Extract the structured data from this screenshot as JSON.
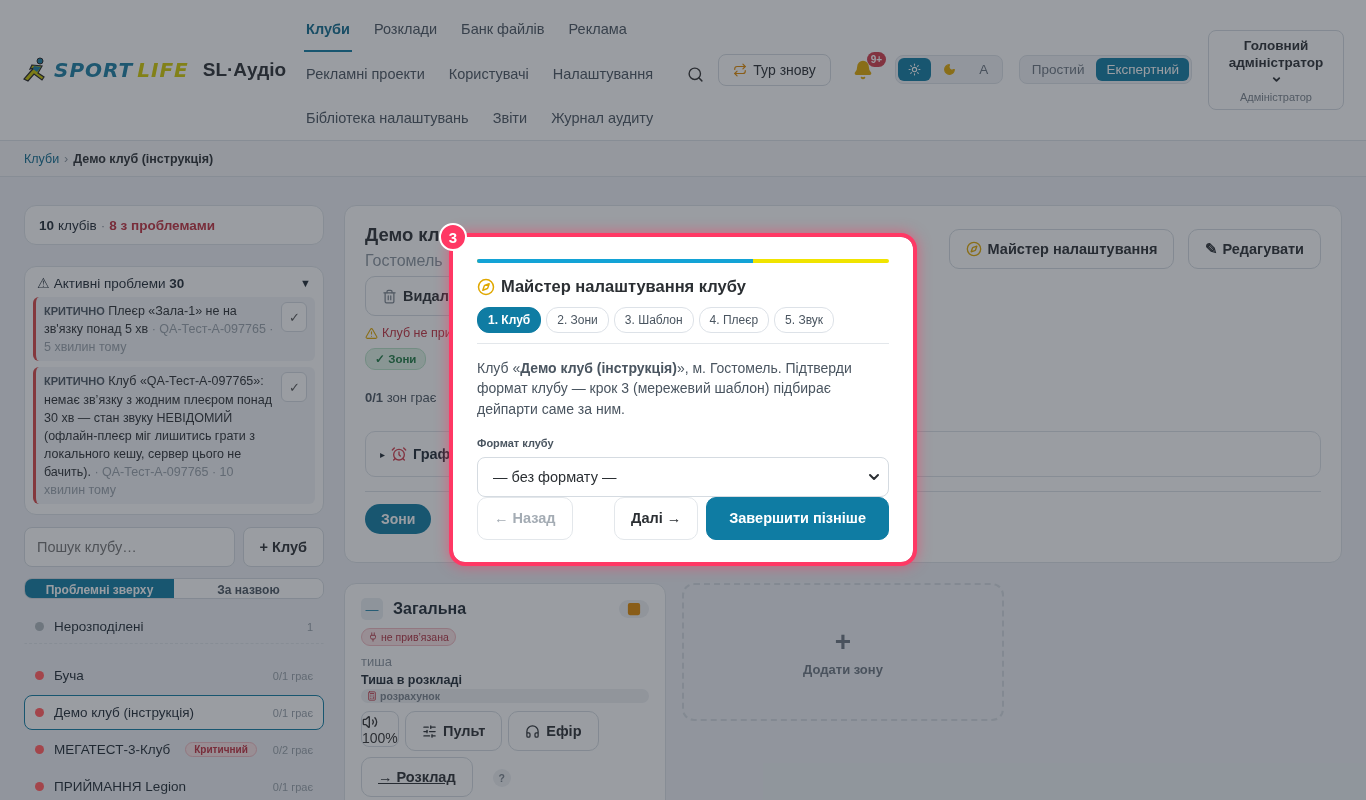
{
  "header": {
    "logo": {
      "word1": "SPORT",
      "word2": "LIFE"
    },
    "app_name": "SL·Аудіо",
    "nav_rows": [
      [
        {
          "label": "Клуби",
          "selected": true
        },
        {
          "label": "Розклади",
          "selected": false
        },
        {
          "label": "Банк файлів",
          "selected": false
        },
        {
          "label": "Реклама",
          "selected": false
        }
      ],
      [
        {
          "label": "Рекламні проекти",
          "selected": false
        },
        {
          "label": "Користувачі",
          "selected": false
        },
        {
          "label": "Налаштування",
          "selected": false
        }
      ],
      [
        {
          "label": "Бібліотека налаштувань",
          "selected": false
        },
        {
          "label": "Звіти",
          "selected": false
        },
        {
          "label": "Журнал аудиту",
          "selected": false
        }
      ]
    ],
    "tour_button": "Тур знову",
    "notifications_badge": "9+",
    "theme_options": [
      {
        "kind": "sun",
        "selected": true
      },
      {
        "kind": "moon",
        "selected": false
      },
      {
        "kind": "text",
        "label": "A",
        "selected": false
      }
    ],
    "mode_options": [
      {
        "label": "Простий",
        "selected": false
      },
      {
        "label": "Експертний",
        "selected": true
      }
    ],
    "user": {
      "name": "Головний адміністратор",
      "role": "Адміністратор"
    }
  },
  "breadcrumb": {
    "items": [
      {
        "label": "Клуби",
        "kind": "link"
      },
      {
        "label": "Демо клуб (інструкція)",
        "kind": "current"
      }
    ],
    "separator": "›"
  },
  "sidebar": {
    "summary": {
      "count": "10",
      "label": "клубів",
      "separator": "·",
      "problems": "8 з проблемами"
    },
    "issues": {
      "icon": "⚠",
      "title": "Активні проблеми",
      "count": "30",
      "toggle": "▼",
      "items": [
        {
          "level": "КРИТИЧНО",
          "message": "Плеєр «Зала-1» не на зв'язку понад 5 хв",
          "meta": "· QA-Тест-А-097765 · 5 хвилин тому",
          "button": "✓"
        },
        {
          "level": "КРИТИЧНО",
          "message": "Клуб «QA-Тест-А-097765»: немає зв’язку з жодним плеєром понад 30 хв — стан звуку НЕВІДОМИЙ (офлайн-плеєр міг лишитись грати з локального кешу, сервер цього не бачить).",
          "meta": "· QA-Тест-А-097765 · 10 хвилин тому",
          "button": "✓"
        }
      ]
    },
    "search": {
      "placeholder": "Пошук клубу…"
    },
    "add_button": "+ Клуб",
    "sort_tabs": [
      {
        "label": "Проблемні зверху",
        "selected": true
      },
      {
        "label": "За назвою",
        "selected": false
      }
    ],
    "clubs": [
      {
        "kind": "group",
        "name": "Нерозподілені",
        "color": "#6e767e",
        "count": "1",
        "selected": false
      },
      {
        "kind": "club",
        "name": "Буча",
        "color": "#a3454b",
        "status": "0/1 грає",
        "selected": false
      },
      {
        "kind": "club",
        "name": "Демо клуб (інструкція)",
        "color": "#a3454b",
        "status": "0/1 грає",
        "selected": true
      },
      {
        "kind": "club",
        "name": "МЕГАТЕСТ-3-Клуб",
        "color": "#a3454b",
        "tag": "Критичний",
        "status": "0/2 грає",
        "selected": false
      },
      {
        "kind": "club",
        "name": "ПРИЙМАННЯ Legion",
        "color": "#a3454b",
        "status": "0/1 грає",
        "selected": false
      }
    ]
  },
  "club": {
    "title": "Демо кл",
    "city": "Гостомель",
    "wizard_button": "Майстер налаштування",
    "edit_button": "✎ Редагувати",
    "delete_button": "Видал",
    "warning": "Клуб не при",
    "chip": "✓ Зони",
    "playing_count": "0/1",
    "playing_label": "зон грає",
    "schedule_toggle": "▸",
    "schedule_label": "Граф",
    "tabs": [
      {
        "label": "Зони",
        "selected": true
      }
    ]
  },
  "zones": [
    {
      "name": "Загальна",
      "collapse": "—",
      "binding": "не прив’язана",
      "state": "тиша",
      "schedule": "Тиша в розкладі",
      "source": "розрахунок",
      "volume": "100%",
      "buttons": [
        "Пульт",
        "Ефір"
      ],
      "schedule_link": "→ Розклад",
      "help": "?"
    }
  ],
  "add_zone": {
    "plus": "+",
    "label": "Додати зону"
  },
  "wizard": {
    "step_badge": "3",
    "level": 0.67,
    "title": "Майстер налаштування клубу",
    "steps": [
      {
        "label": "1. Клуб",
        "selected": true
      },
      {
        "label": "2. Зони",
        "selected": false
      },
      {
        "label": "3. Шаблон",
        "selected": false
      },
      {
        "label": "4. Плеєр",
        "selected": false
      },
      {
        "label": "5. Звук",
        "selected": false
      }
    ],
    "text": "Клуб «**Демо клуб (інструкція)**», м. Гостомель. Підтверди формат клубу — крок 3 (мережевий шаблон) підбирає дейпарти саме за ним.",
    "field_label": "Формат клубу",
    "format_value": "— без формату —",
    "back_button": {
      "label": "← Назад",
      "disabled": true
    },
    "next_button": "Далі →",
    "finish_button": "Завершити пізніше"
  }
}
